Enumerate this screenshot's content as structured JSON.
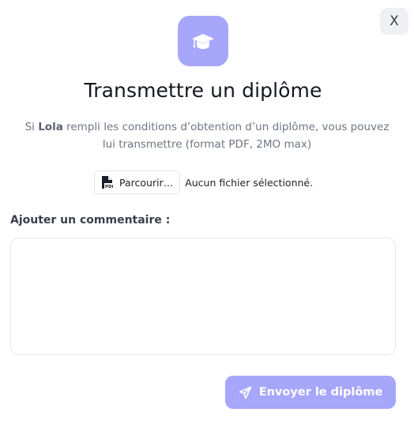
{
  "modal": {
    "close_label": "X",
    "icon": "graduation-cap-icon",
    "title": "Transmettre un diplôme",
    "subtitle_before": "Si ",
    "subtitle_name": "Lola",
    "subtitle_after": " rempli les conditions d’obtention d’un diplôme, vous pouvez lui transmettre (format PDF, 2MO max)"
  },
  "file_input": {
    "icon": "pdf-file-icon",
    "button_label": "Parcourir…",
    "status": "Aucun fichier sélectionné."
  },
  "comment": {
    "label": "Ajouter un commentaire :",
    "value": "",
    "placeholder": ""
  },
  "submit": {
    "icon": "paper-plane-icon",
    "label": "Envoyer le diplôme"
  },
  "colors": {
    "accent": "#a6a6fb",
    "close_bg": "#eff0f3",
    "title_text": "#14171f",
    "muted_text": "#6f7583",
    "border": "#e3e5eb"
  }
}
